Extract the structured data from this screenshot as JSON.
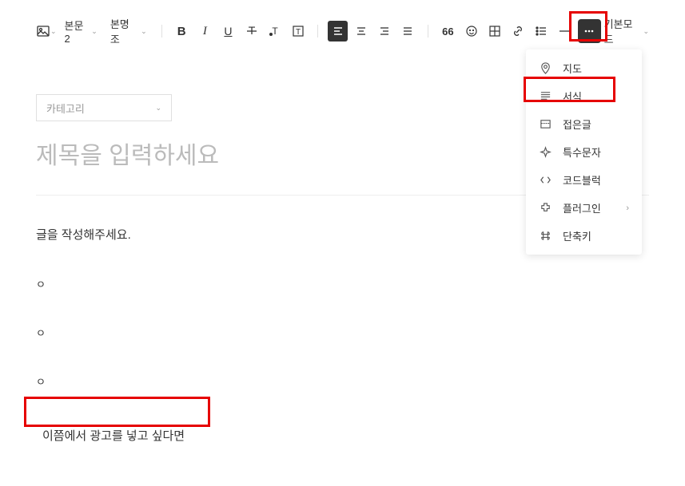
{
  "toolbar": {
    "image_icon": "image-icon",
    "paragraph_style": "본문2",
    "font_family": "본명조",
    "bold": "B",
    "italic": "I",
    "underline": "U",
    "strike": "T",
    "color_label": "T",
    "textbox_label": "T",
    "quote": "66",
    "more_dots": "⋯"
  },
  "mode": {
    "label": "기본모드"
  },
  "dropdown": {
    "items": [
      {
        "icon": "map-pin-icon",
        "label": "지도"
      },
      {
        "icon": "template-icon",
        "label": "서식"
      },
      {
        "icon": "fold-icon",
        "label": "접은글"
      },
      {
        "icon": "special-char-icon",
        "label": "특수문자"
      },
      {
        "icon": "code-icon",
        "label": "코드블럭"
      },
      {
        "icon": "plugin-icon",
        "label": "플러그인",
        "arrow": true
      },
      {
        "icon": "shortcut-icon",
        "label": "단축키"
      }
    ]
  },
  "content": {
    "category_placeholder": "카테고리",
    "title_placeholder": "제목을 입력하세요",
    "body_placeholder": "글을 작성해주세요.",
    "spacer": "ㅇ",
    "ad_text": "이쯤에서 광고를 넣고 싶다면"
  }
}
